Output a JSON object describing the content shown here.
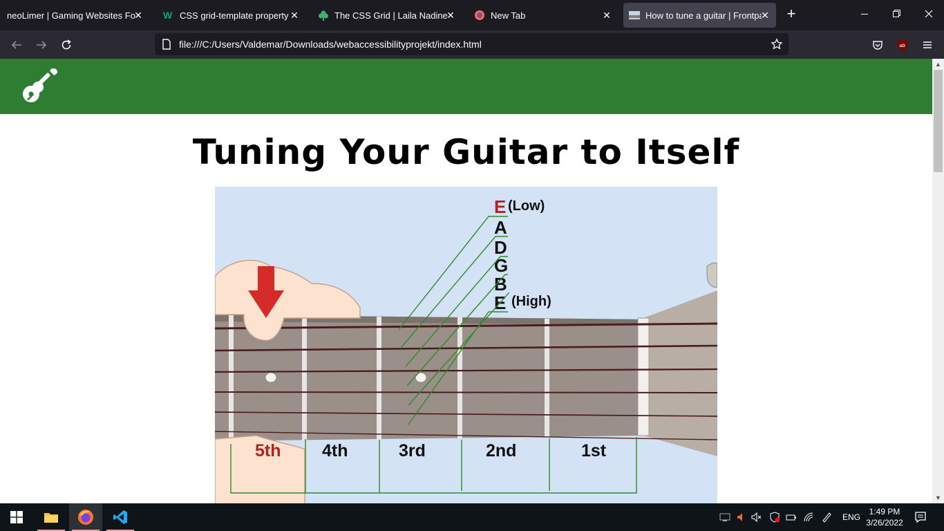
{
  "tabs": [
    {
      "title": "neoLimer | Gaming Websites For Your",
      "icon": "neolimer-favicon"
    },
    {
      "title": "CSS grid-template property",
      "icon": "w3schools-favicon"
    },
    {
      "title": "The CSS Grid | Laila Nadine",
      "icon": "clover-favicon"
    },
    {
      "title": "New Tab",
      "icon": "firefox-favicon"
    },
    {
      "title": "How to tune a guitar | Frontpage",
      "icon": "page-thumbnail-favicon",
      "active": true
    }
  ],
  "window_controls": {
    "minimize": "—",
    "restore": "❐",
    "close": "✕"
  },
  "address_bar": {
    "url": "file:///C:/Users/Valdemar/Downloads/webaccessibilityprojekt/index.html"
  },
  "page": {
    "header_color": "#2e7d32",
    "logo_icon": "guitar-icon",
    "title": "Tuning Your Guitar to Itself",
    "illustration": {
      "strings": [
        {
          "note": "E",
          "suffix": "(Low)",
          "highlight": true
        },
        {
          "note": "A",
          "suffix": ""
        },
        {
          "note": "D",
          "suffix": ""
        },
        {
          "note": "G",
          "suffix": ""
        },
        {
          "note": "B",
          "suffix": ""
        },
        {
          "note": "E",
          "suffix": "(High)",
          "highlight": false
        }
      ],
      "frets": [
        {
          "label": "5th",
          "highlight": true
        },
        {
          "label": "4th",
          "highlight": false
        },
        {
          "label": "3rd",
          "highlight": false
        },
        {
          "label": "2nd",
          "highlight": false
        },
        {
          "label": "1st",
          "highlight": false
        }
      ]
    }
  },
  "taskbar": {
    "apps": [
      "start-icon",
      "file-explorer-icon",
      "firefox-icon",
      "vscode-icon"
    ],
    "language": "ENG",
    "time": "1:49 PM",
    "date": "3/26/2022"
  }
}
